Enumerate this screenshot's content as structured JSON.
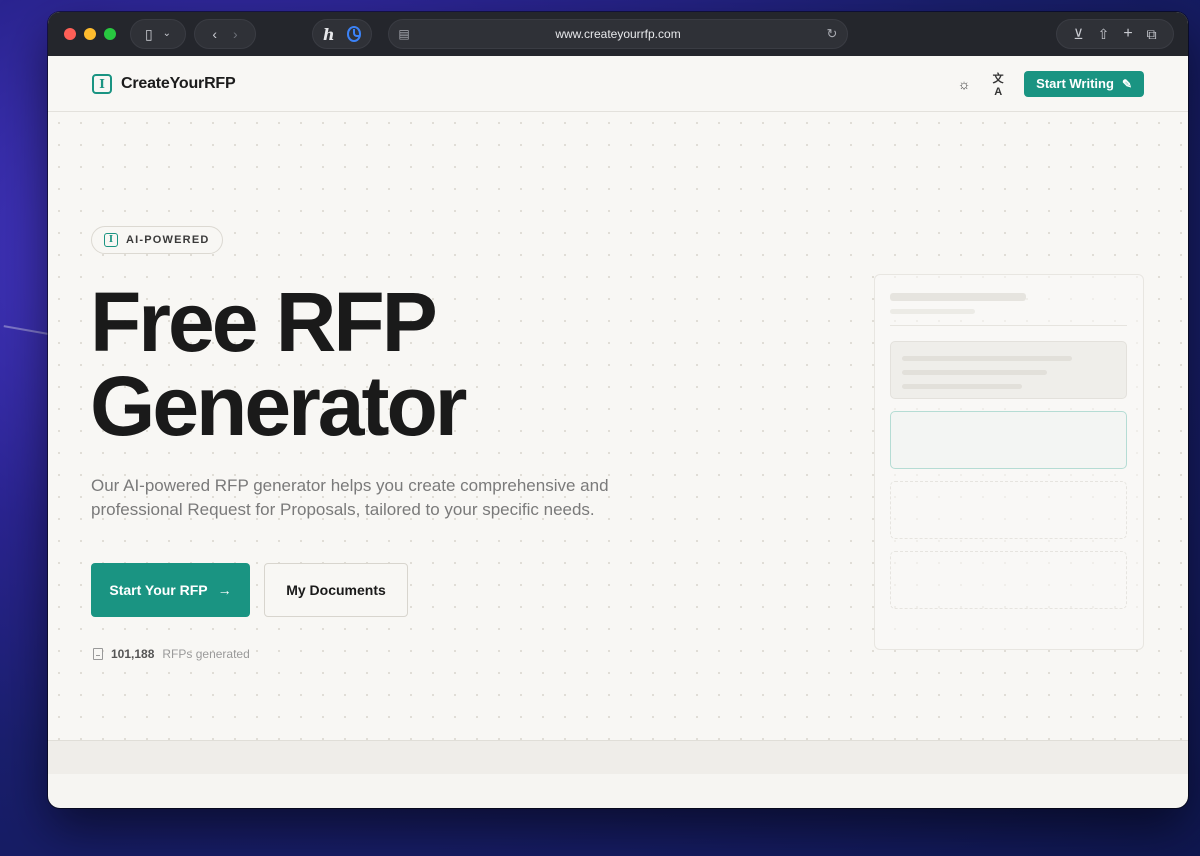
{
  "browser": {
    "url": "www.createyourrfp.com"
  },
  "site": {
    "logo_text": "CreateYourRFP",
    "logo_glyph": "I",
    "header_cta": "Start Writing"
  },
  "hero": {
    "badge": "AI-POWERED",
    "title_line1": "Free RFP",
    "title_line2": "Generator",
    "subtitle": "Our AI-powered RFP generator helps you create comprehensive and professional Request for Proposals, tailored to your specific needs.",
    "primary_button": "Start Your RFP",
    "secondary_button": "My Documents",
    "stats_count": "101,188",
    "stats_label": "RFPs generated"
  },
  "colors": {
    "accent": "#1a9482",
    "text": "#1a1a1a",
    "muted": "#7a7a7a"
  },
  "icons": {
    "toolbar": [
      "sidebar-icon",
      "chevron-down-icon",
      "back-icon",
      "forward-icon",
      "download-icon",
      "share-icon",
      "new-tab-icon",
      "tabs-overview-icon",
      "reader-icon",
      "reload-icon"
    ],
    "header": [
      "sun-icon",
      "translate-icon",
      "pen-icon"
    ],
    "hero": [
      "arrow-right-icon",
      "document-icon"
    ]
  }
}
